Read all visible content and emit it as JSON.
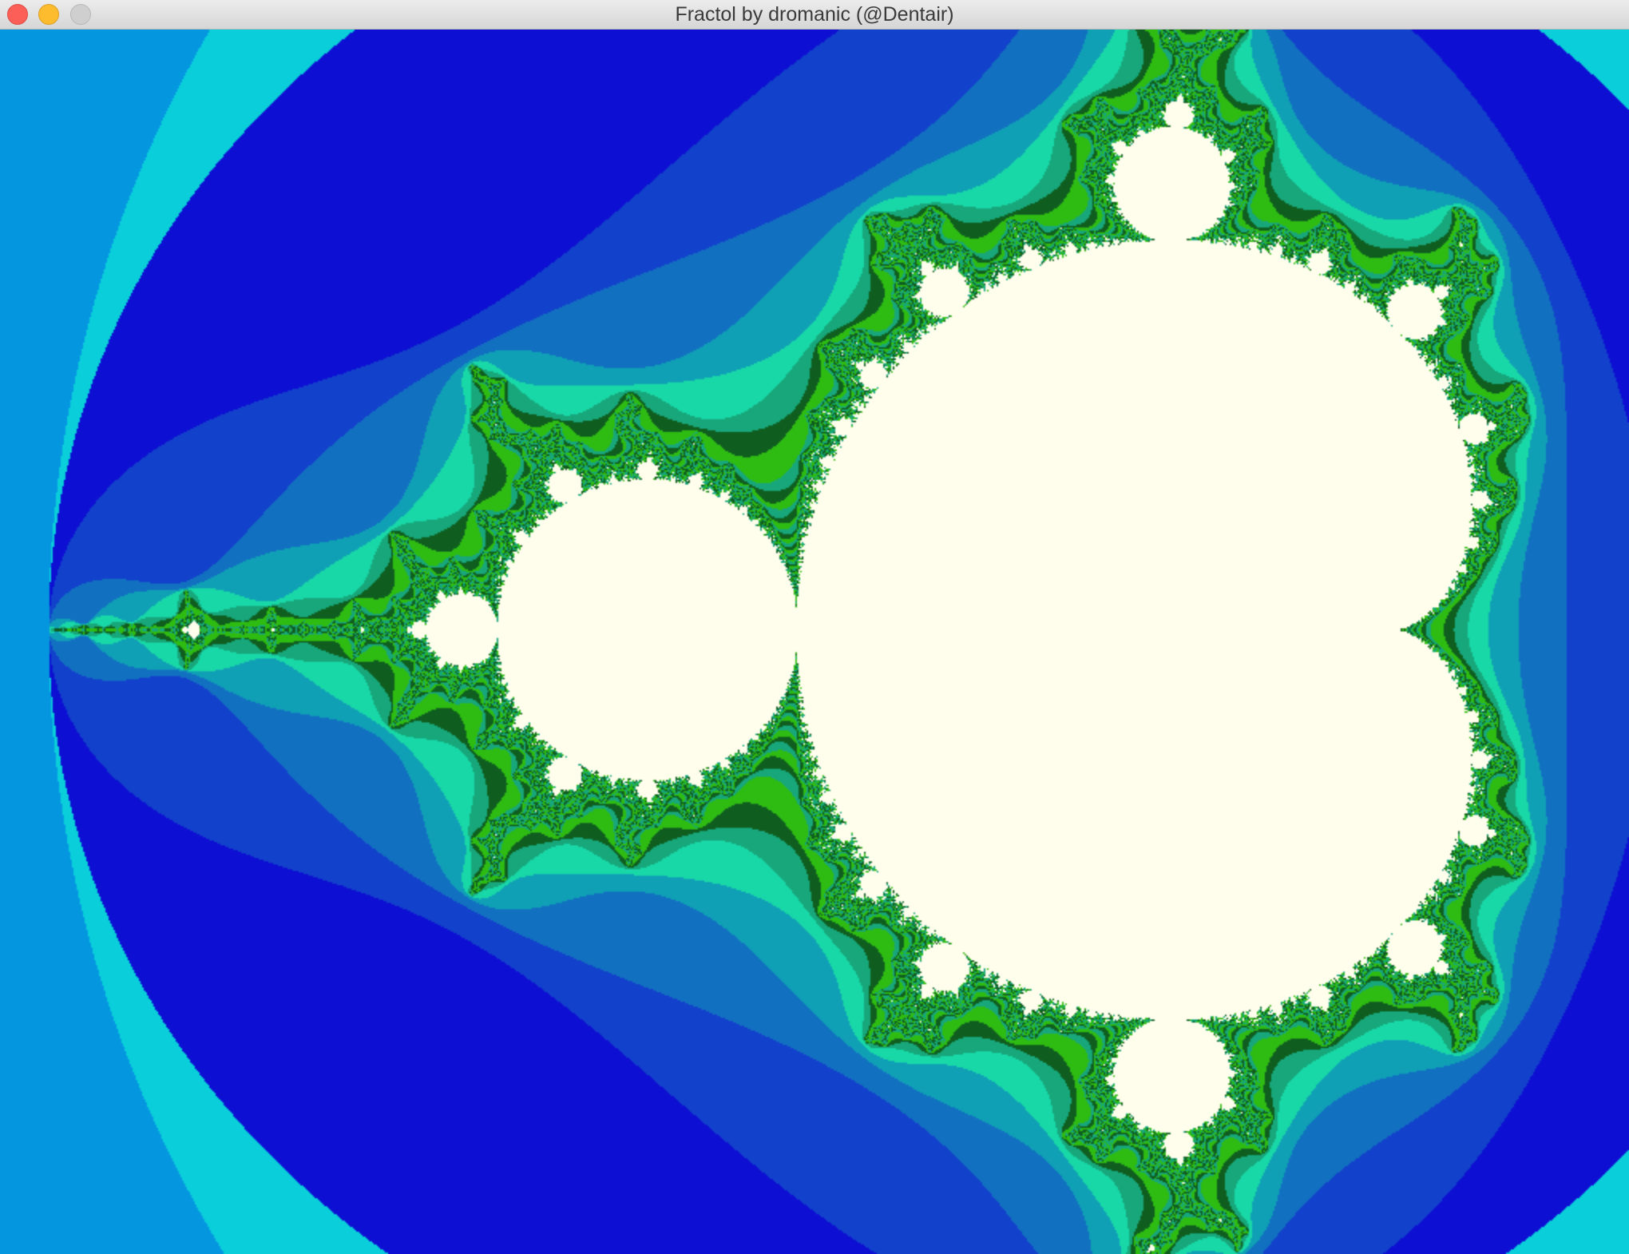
{
  "window": {
    "title": "Fractol by dromanic (@Dentair)",
    "buttons": [
      {
        "name": "close",
        "color": "#fc5f57"
      },
      {
        "name": "minimize",
        "color": "#fdbc2e"
      },
      {
        "name": "zoom",
        "color": "#cfcfcf"
      }
    ]
  },
  "fractal": {
    "type": "mandelbrot",
    "set_color": "#fffdec",
    "palette": [
      "#0a6ceb",
      "#0596e0",
      "#0acfdb",
      "#0d0fd2",
      "#1241cb",
      "#1270c1",
      "#0fa0b6",
      "#19d8a7",
      "#17a77b",
      "#0f5e20",
      "#2fbc12"
    ]
  }
}
